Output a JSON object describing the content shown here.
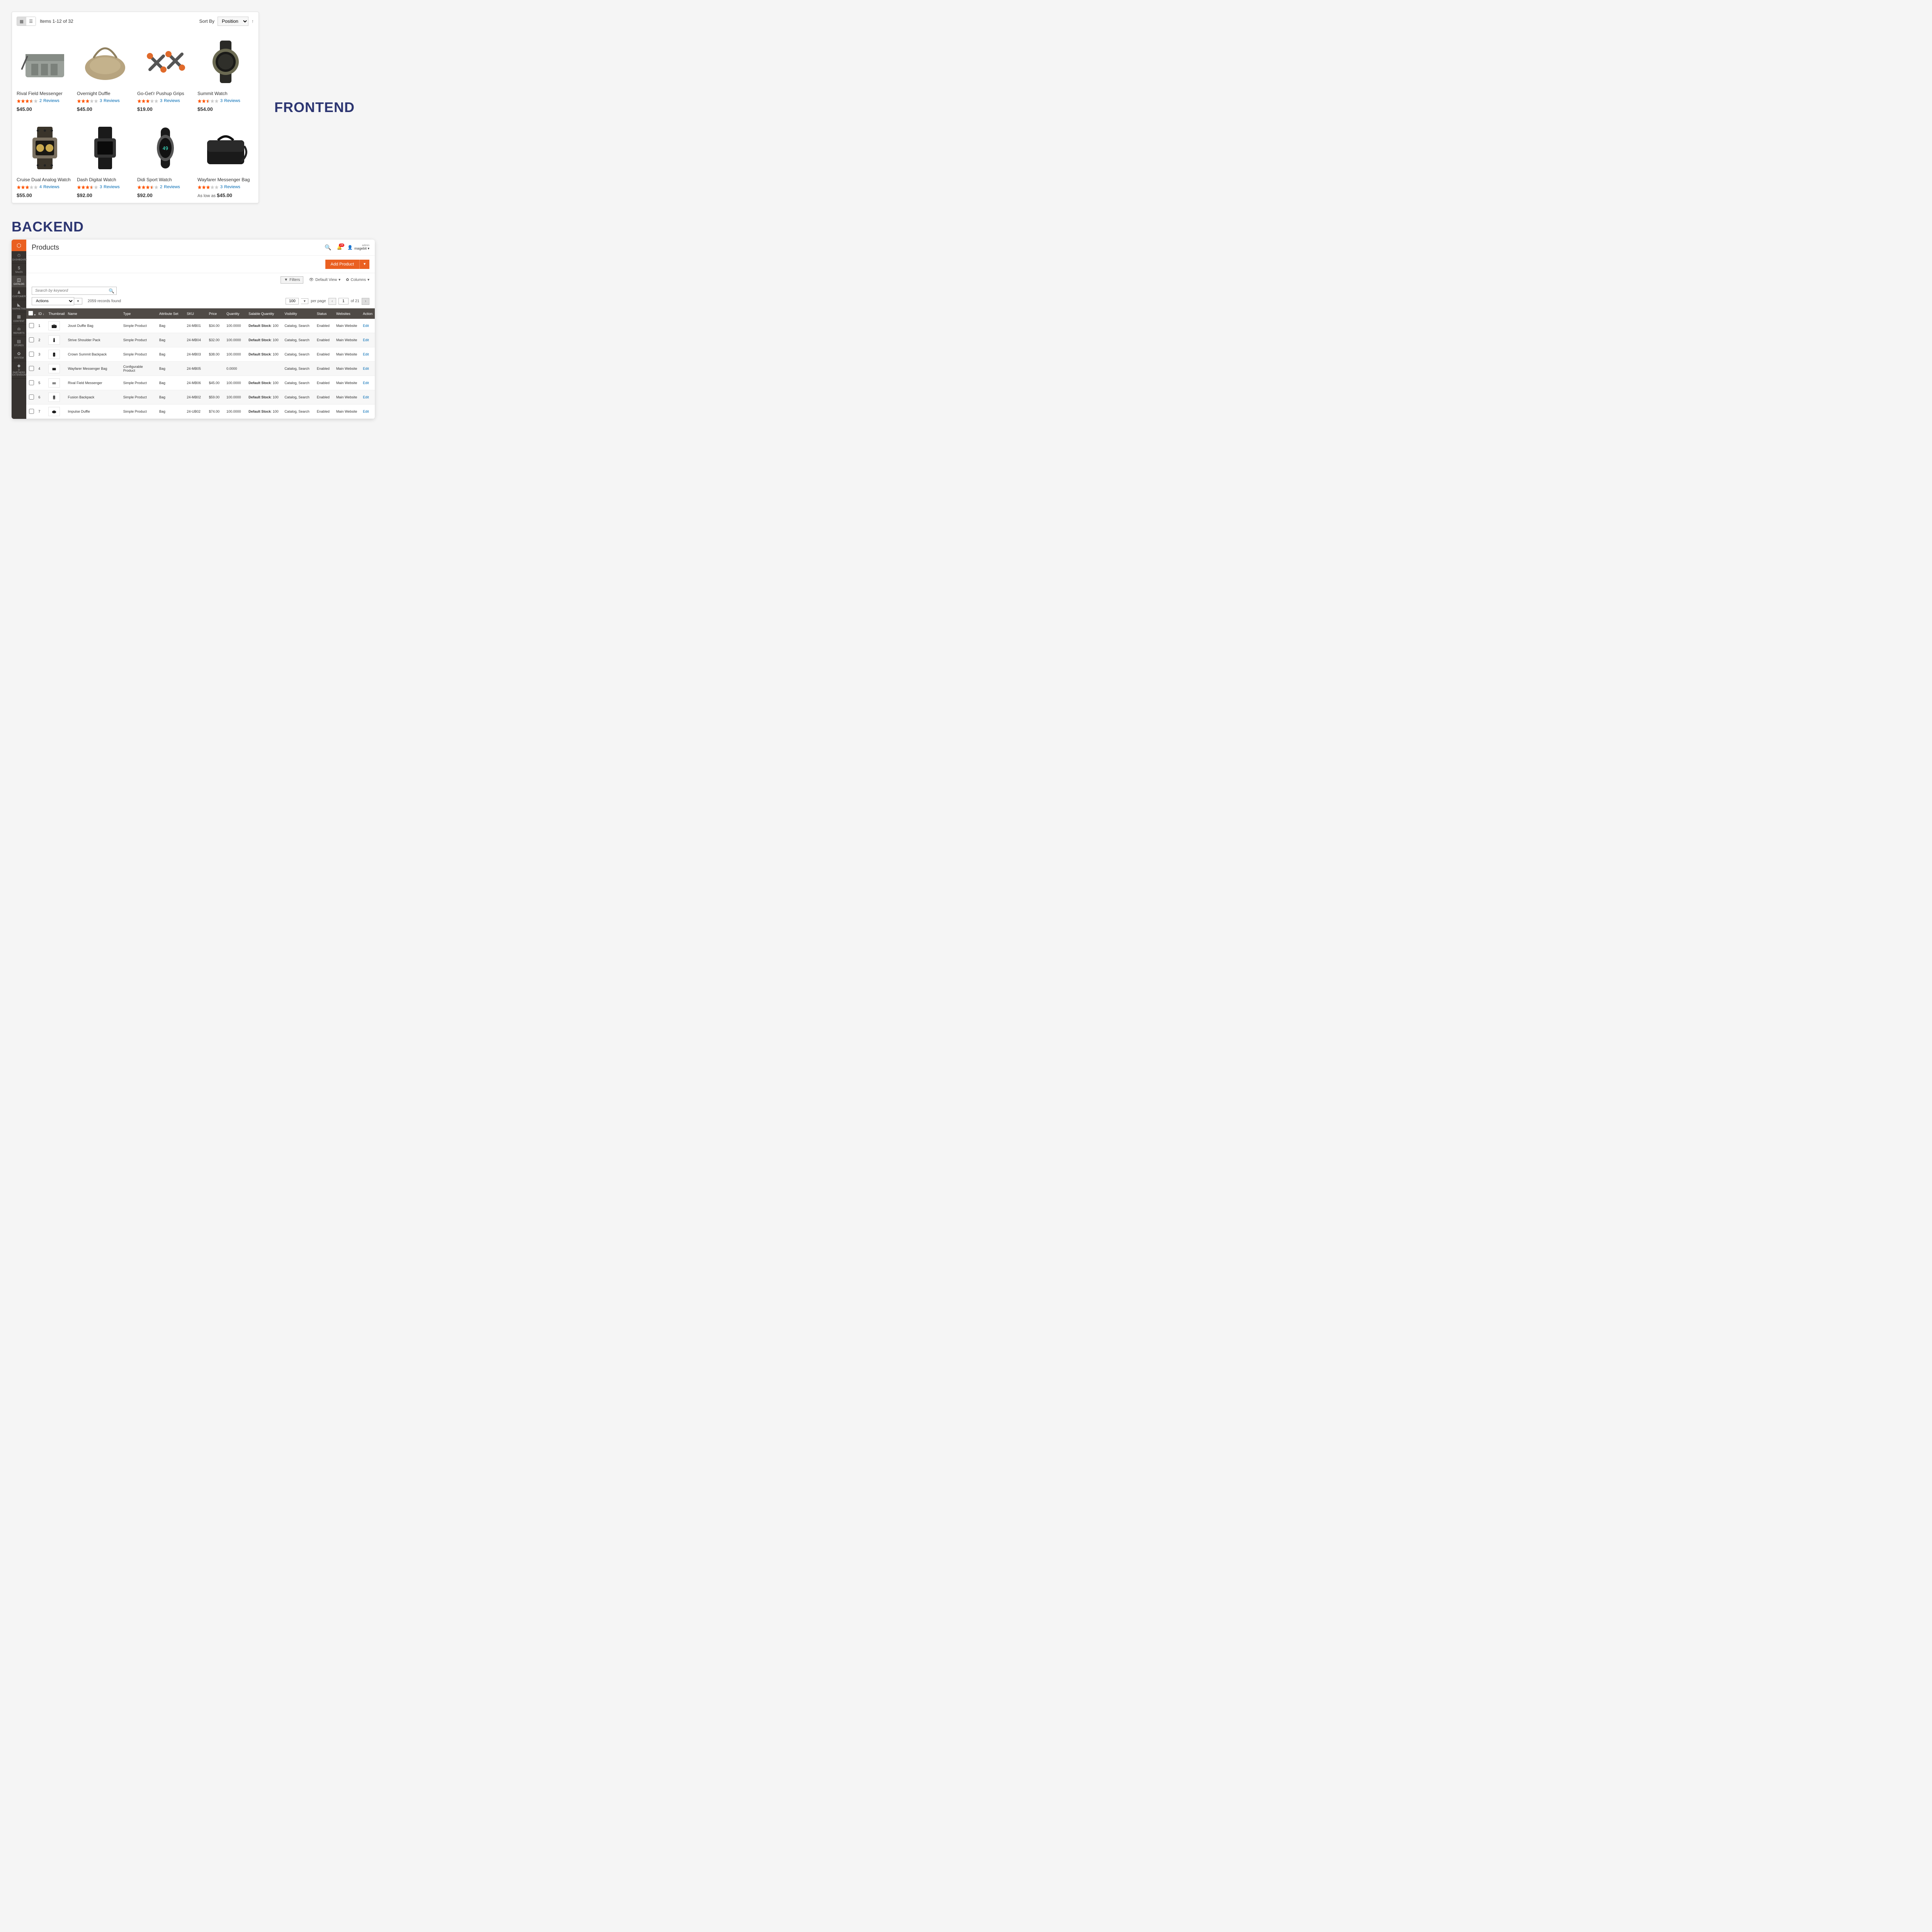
{
  "labels": {
    "frontend_title": "FRONTEND",
    "backend_title": "BACKEND",
    "reviews_word": "Reviews",
    "as_low_as": "As low as"
  },
  "frontend": {
    "items_count": "Items 1-12 of 32",
    "sort_by_label": "Sort By",
    "sort_value": "Position",
    "products": [
      {
        "name": "Rival Field Messenger",
        "rating": 3.5,
        "reviews": 2,
        "price": "$45.00",
        "img": "bag-gray"
      },
      {
        "name": "Overnight Duffle",
        "rating": 3.0,
        "reviews": 3,
        "price": "$45.00",
        "img": "bag-tan"
      },
      {
        "name": "Go-Get'r Pushup Grips",
        "rating": 3.0,
        "reviews": 3,
        "price": "$19.00",
        "img": "grips"
      },
      {
        "name": "Summit Watch",
        "rating": 2.5,
        "reviews": 3,
        "price": "$54.00",
        "img": "watch-round"
      },
      {
        "name": "Cruise Dual Analog Watch",
        "rating": 3.0,
        "reviews": 4,
        "price": "$55.00",
        "img": "watch-square-gold"
      },
      {
        "name": "Dash Digital Watch",
        "rating": 3.5,
        "reviews": 3,
        "price": "$92.00",
        "img": "watch-square-black"
      },
      {
        "name": "Didi Sport Watch",
        "rating": 3.5,
        "reviews": 2,
        "price": "$92.00",
        "img": "watch-oval"
      },
      {
        "name": "Wayfarer Messenger Bag",
        "rating": 3.0,
        "reviews": 3,
        "price": "$45.00",
        "price_prefix": "As low as",
        "img": "bag-black"
      }
    ]
  },
  "backend": {
    "page_title": "Products",
    "user_role": "admin",
    "user_name": "magebit",
    "notif_count": "24",
    "add_button": "Add Product",
    "filters_label": "Filters",
    "default_view_label": "Default View",
    "columns_label": "Columns",
    "search_placeholder": "Search by keyword",
    "actions_label": "Actions",
    "records_found": "2059 records found",
    "per_page_value": "100",
    "per_page_label": "per page",
    "page_value": "1",
    "page_total": "of 21",
    "edit_label": "Edit",
    "nav": [
      {
        "icon": "⏱",
        "label": "DASHBOARD"
      },
      {
        "icon": "$",
        "label": "SALES"
      },
      {
        "icon": "◫",
        "label": "CATALOG",
        "active": true
      },
      {
        "icon": "♟",
        "label": "CUSTOMERS"
      },
      {
        "icon": "◣",
        "label": "MARKETING"
      },
      {
        "icon": "▦",
        "label": "CONTENT"
      },
      {
        "icon": "ılı",
        "label": "REPORTS"
      },
      {
        "icon": "▤",
        "label": "STORES"
      },
      {
        "icon": "✿",
        "label": "SYSTEM"
      },
      {
        "icon": "◆",
        "label": "D PARTNERS EXTENSIONS"
      }
    ],
    "columns": [
      "",
      "ID",
      "Thumbnail",
      "Name",
      "Type",
      "Attribute Set",
      "SKU",
      "Price",
      "Quantity",
      "Salable Quantity",
      "Visibility",
      "Status",
      "Websites",
      "Action"
    ],
    "rows": [
      {
        "id": "1",
        "name": "Joust Duffle Bag",
        "type": "Simple Product",
        "attr": "Bag",
        "sku": "24-MB01",
        "price": "$34.00",
        "qty": "100.0000",
        "sal": "Default Stock: 100",
        "vis": "Catalog, Search",
        "status": "Enabled",
        "web": "Main Website",
        "thumb": "bag-black"
      },
      {
        "id": "2",
        "name": "Strive Shoulder Pack",
        "type": "Simple Product",
        "attr": "Bag",
        "sku": "24-MB04",
        "price": "$32.00",
        "qty": "100.0000",
        "sal": "Default Stock: 100",
        "vis": "Catalog, Search",
        "status": "Enabled",
        "web": "Main Website",
        "thumb": "pack-black"
      },
      {
        "id": "3",
        "name": "Crown Summit Backpack",
        "type": "Simple Product",
        "attr": "Bag",
        "sku": "24-MB03",
        "price": "$38.00",
        "qty": "100.0000",
        "sal": "Default Stock: 100",
        "vis": "Catalog, Search",
        "status": "Enabled",
        "web": "Main Website",
        "thumb": "backpack"
      },
      {
        "id": "4",
        "name": "Wayfarer Messenger Bag",
        "type": "Configurable Product",
        "attr": "Bag",
        "sku": "24-MB05",
        "price": "",
        "qty": "0.0000",
        "sal": "",
        "vis": "Catalog, Search",
        "status": "Enabled",
        "web": "Main Website",
        "thumb": "msgr-black"
      },
      {
        "id": "5",
        "name": "Rival Field Messenger",
        "type": "Simple Product",
        "attr": "Bag",
        "sku": "24-MB06",
        "price": "$45.00",
        "qty": "100.0000",
        "sal": "Default Stock: 100",
        "vis": "Catalog, Search",
        "status": "Enabled",
        "web": "Main Website",
        "thumb": "msgr-gray"
      },
      {
        "id": "6",
        "name": "Fusion Backpack",
        "type": "Simple Product",
        "attr": "Bag",
        "sku": "24-MB02",
        "price": "$59.00",
        "qty": "100.0000",
        "sal": "Default Stock: 100",
        "vis": "Catalog, Search",
        "status": "Enabled",
        "web": "Main Website",
        "thumb": "backpack-gray"
      },
      {
        "id": "7",
        "name": "Impulse Duffle",
        "type": "Simple Product",
        "attr": "Bag",
        "sku": "24-UB02",
        "price": "$74.00",
        "qty": "100.0000",
        "sal": "Default Stock: 100",
        "vis": "Catalog, Search",
        "status": "Enabled",
        "web": "Main Website",
        "thumb": "duffle-black"
      }
    ]
  }
}
